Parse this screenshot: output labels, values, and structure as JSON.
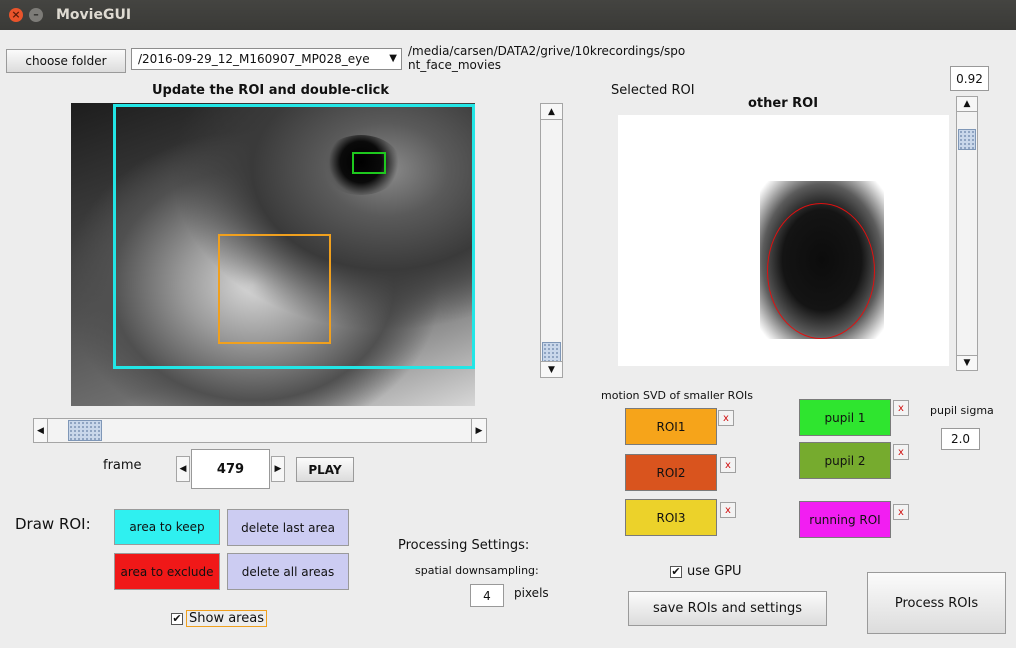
{
  "window": {
    "title": "MovieGUI",
    "close_glyph": "×",
    "min_glyph": "–"
  },
  "toolbar": {
    "choose_folder_label": "choose folder",
    "file_select_value": "/2016-09-29_12_M160907_MP028_eye",
    "path_line1": "/media/carsen/DATA2/grive/10krecordings/spo",
    "path_line2": "nt_face_movies"
  },
  "video": {
    "heading": "Update the ROI and double-click",
    "rois": {
      "keep_color": "#22e6e6",
      "pupil_color": "#1ec81e",
      "motion_color": "#f0a01e"
    }
  },
  "frame": {
    "label": "frame",
    "value": "479",
    "play_label": "PLAY",
    "slider_position": 0.05,
    "left_arrow": "◀",
    "right_arrow": "▶"
  },
  "draw_roi": {
    "label": "Draw ROI:",
    "area_keep": "area to keep",
    "area_exclude": "area to exclude",
    "delete_last": "delete last area",
    "delete_all": "delete all areas",
    "show_areas_label": "Show areas",
    "show_areas_checked": true,
    "check_glyph": "✔"
  },
  "processing": {
    "heading": "Processing Settings:",
    "spatial_label": "spatial downsampling:",
    "spatial_value": "4",
    "units": "pixels"
  },
  "selected_roi": {
    "label": "Selected ROI",
    "title": "other ROI",
    "sigma_value": "0.92",
    "vscroll_arrow_up": "▲",
    "vscroll_arrow_down": "▼"
  },
  "motion": {
    "heading": "motion SVD of smaller ROIs",
    "roi1": "ROI1",
    "roi2": "ROI2",
    "roi3": "ROI3",
    "remove_glyph": "x"
  },
  "pupil": {
    "pupil1": "pupil 1",
    "pupil2": "pupil 2",
    "running": "running ROI",
    "sigma_label": "pupil sigma",
    "sigma_value": "2.0"
  },
  "gpu": {
    "label": "use GPU",
    "checked": true
  },
  "actions": {
    "save": "save ROIs and settings",
    "process": "Process ROIs"
  },
  "colors": {
    "roi1": "#f6a41a",
    "roi2": "#d9541e",
    "roi3": "#ecd22a",
    "pupil1": "#2fe52f",
    "pupil2": "#76ab2e",
    "running": "#f21ef2",
    "area_keep": "#2ff0f0",
    "area_exclude": "#f01818",
    "delete": "#ccccf2"
  }
}
